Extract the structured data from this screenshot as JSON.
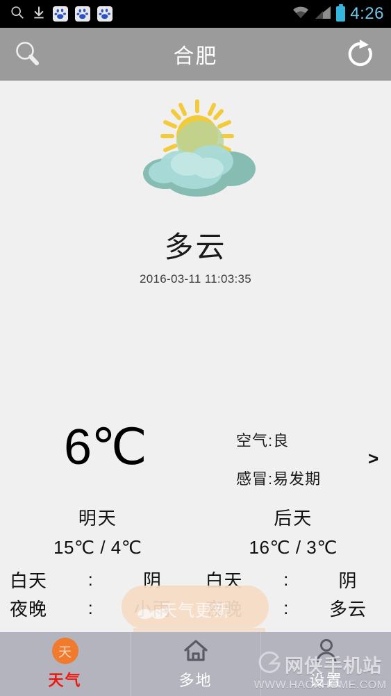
{
  "status_bar": {
    "time": "4:26",
    "icons": [
      "search-icon",
      "download-icon",
      "baidu-icon",
      "baidu-icon",
      "baidu-icon"
    ],
    "right_icons": [
      "wifi-icon",
      "signal-icon",
      "battery-icon"
    ],
    "baidu_glyph": "du"
  },
  "action_bar": {
    "title": "合肥",
    "search_icon": "search-icon",
    "refresh_icon": "refresh-icon",
    "bg_color": "#9b9b9b"
  },
  "current": {
    "condition": "多云",
    "timestamp": "2016-03-11 11:03:35",
    "temperature": "6℃",
    "air_quality": "空气:良",
    "cold_index": "感冒:易发期",
    "detail_chevron": ">",
    "weather_icon": "partly-cloudy-icon"
  },
  "forecast": [
    {
      "day": "明天",
      "temp_range": "15℃ / 4℃",
      "rows": [
        {
          "label": "白天",
          "colon": ":",
          "value": "阴"
        },
        {
          "label": "夜晚",
          "colon": ":",
          "value": "小雨"
        }
      ]
    },
    {
      "day": "后天",
      "temp_range": "16℃ / 3℃",
      "rows": [
        {
          "label": "白天",
          "colon": ":",
          "value": "阴"
        },
        {
          "label": "夜晚",
          "colon": ":",
          "value": "多云"
        }
      ]
    }
  ],
  "toast": {
    "text": "天气更新",
    "bg_color": "#f6dcc6"
  },
  "bottom_nav": {
    "items": [
      {
        "label": "天气",
        "icon": "sun-badge-icon",
        "badge_text": "天",
        "active": true
      },
      {
        "label": "多地",
        "icon": "home-icon",
        "active": false
      },
      {
        "label": "设置",
        "icon": "person-icon",
        "active": false
      }
    ],
    "active_color": "#e8190f",
    "bg_color": "#b4b4bf"
  },
  "watermark": {
    "site_cn": "网侠手机站",
    "site_url": "WWW.HACKHOME.COM"
  }
}
